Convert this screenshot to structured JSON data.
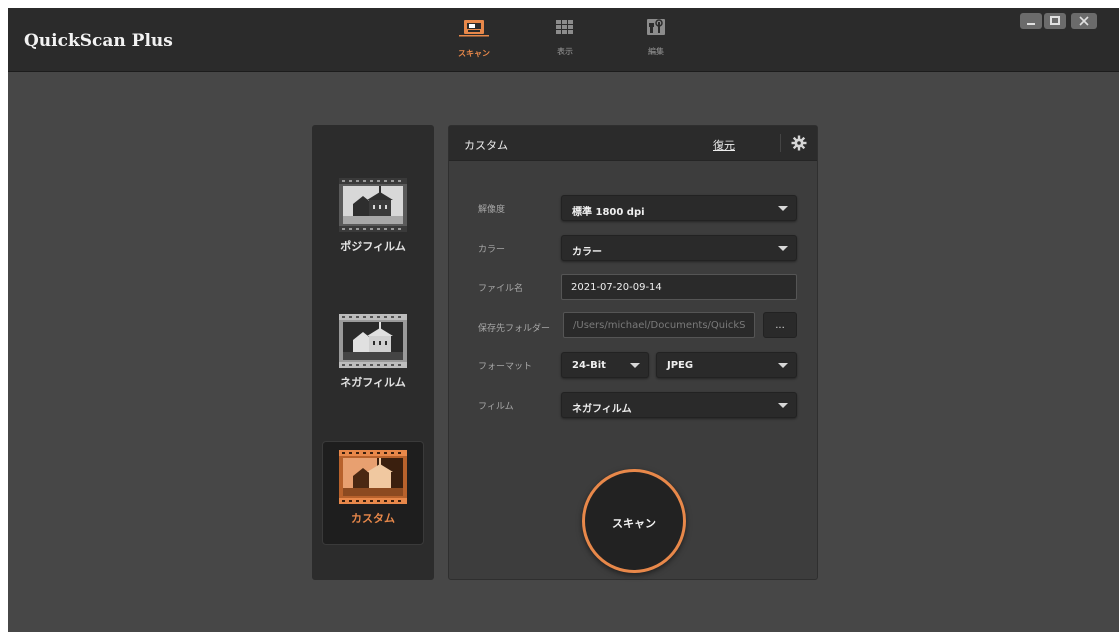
{
  "app": {
    "title": "QuickScan Plus"
  },
  "nav": {
    "tabs": [
      {
        "label": "スキャン",
        "icon": "scanner-icon",
        "active": true
      },
      {
        "label": "表示",
        "icon": "grid-view-icon",
        "active": false
      },
      {
        "label": "編集",
        "icon": "edit-tools-icon",
        "active": false
      }
    ]
  },
  "window_controls": {
    "minimize": "_",
    "maximize": "□",
    "close": "✕"
  },
  "film_types": [
    {
      "label": "ポジフィルム",
      "icon": "positive-film-icon",
      "active": false
    },
    {
      "label": "ネガフィルム",
      "icon": "negative-film-icon",
      "active": false
    },
    {
      "label": "カスタム",
      "icon": "custom-film-icon",
      "active": true
    }
  ],
  "settings": {
    "title": "カスタム",
    "restore_label": "復元",
    "resolution": {
      "label": "解像度",
      "value": "標準 1800 dpi"
    },
    "color": {
      "label": "カラー",
      "value": "カラー"
    },
    "filename": {
      "label": "ファイル名",
      "value": "2021-07-20-09-14"
    },
    "folder": {
      "label": "保存先フォルダー",
      "value": "/Users/michael/Documents/QuickS",
      "browse_label": "..."
    },
    "format": {
      "label": "フォーマット",
      "bit_depth": "24-Bit",
      "file_type": "JPEG"
    },
    "film": {
      "label": "フィルム",
      "value": "ネガフィルム"
    },
    "scan_button": "スキャン"
  },
  "colors": {
    "accent": "#e8884a",
    "titlebar": "#2b2b2b",
    "background": "#474747",
    "panel": "#3d3d3d"
  }
}
